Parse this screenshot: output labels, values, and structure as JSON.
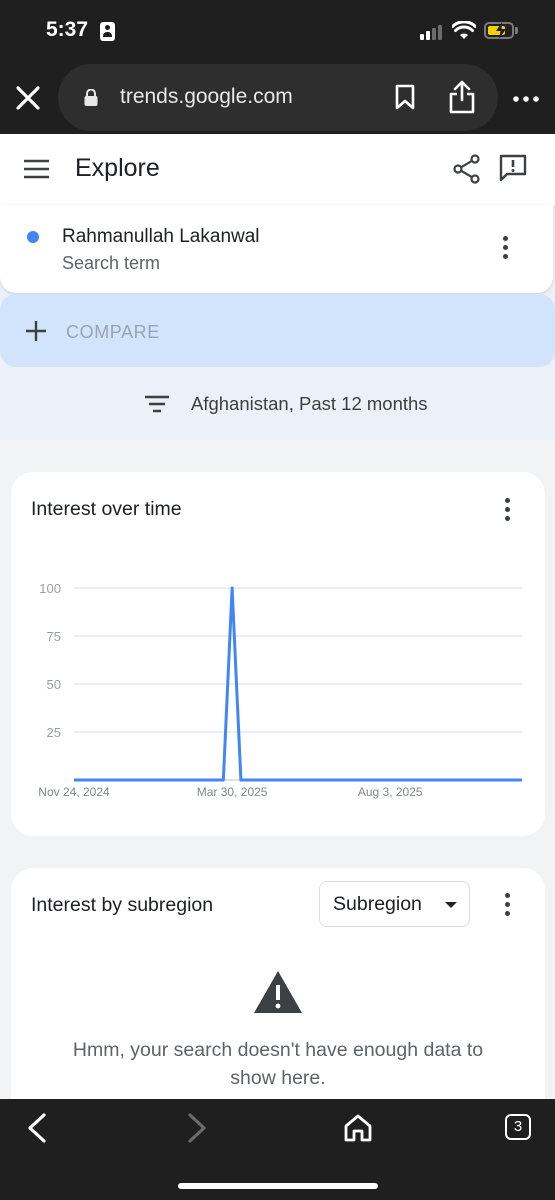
{
  "status_bar": {
    "time": "5:37"
  },
  "browser": {
    "url": "trends.google.com"
  },
  "header": {
    "title": "Explore"
  },
  "search_term": {
    "name": "Rahmanullah Lakanwal",
    "subtitle": "Search term",
    "color": "#4285f4"
  },
  "compare": {
    "label": "COMPARE"
  },
  "filter": {
    "text": "Afghanistan, Past 12 months"
  },
  "interest_over_time": {
    "title": "Interest over time",
    "chart_data": {
      "type": "line",
      "title": "Interest over time",
      "xlabel": "",
      "ylabel": "",
      "x_tick_labels": [
        "Nov 24, 2024",
        "Mar 30, 2025",
        "Aug 3, 2025"
      ],
      "y_ticks": [
        25,
        50,
        75,
        100
      ],
      "ylim": [
        0,
        100
      ],
      "grid": true,
      "series": [
        {
          "color": "#4285f4",
          "points": [
            {
              "x": "Nov 24, 2024",
              "y": 0
            },
            {
              "x": "Mar 23, 2025",
              "y": 0
            },
            {
              "x": "Mar 30, 2025",
              "y": 100
            },
            {
              "x": "Apr 6, 2025",
              "y": 0
            },
            {
              "x": "Nov 16, 2025",
              "y": 0
            }
          ]
        }
      ]
    }
  },
  "subregion": {
    "title": "Interest by subregion",
    "dropdown_label": "Subregion",
    "no_data_message": "Hmm, your search doesn't have enough data to show here."
  },
  "toolbar": {
    "tab_count": "3"
  }
}
